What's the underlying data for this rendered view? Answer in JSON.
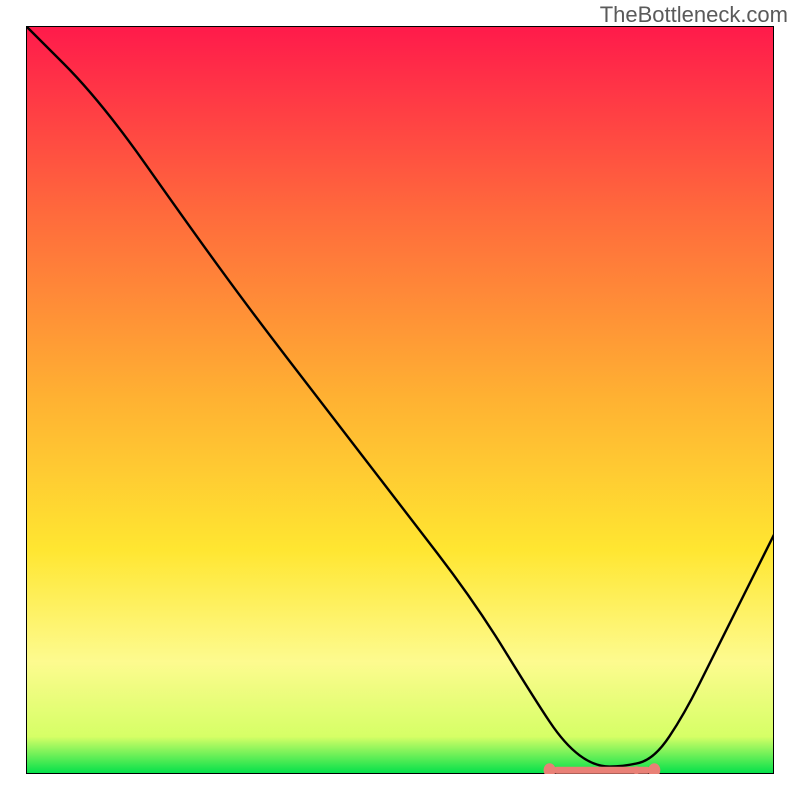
{
  "watermark": "TheBottleneck.com",
  "chart_data": {
    "type": "line",
    "title": "",
    "xlabel": "",
    "ylabel": "",
    "xlim": [
      0,
      100
    ],
    "ylim": [
      0,
      100
    ],
    "background_gradient": {
      "stops": [
        {
          "offset": 0.0,
          "color": "#ff1a4b"
        },
        {
          "offset": 0.25,
          "color": "#ff6a3c"
        },
        {
          "offset": 0.5,
          "color": "#ffb232"
        },
        {
          "offset": 0.7,
          "color": "#ffe631"
        },
        {
          "offset": 0.85,
          "color": "#fdfb8f"
        },
        {
          "offset": 0.95,
          "color": "#d6ff66"
        },
        {
          "offset": 1.0,
          "color": "#00e04a"
        }
      ]
    },
    "series": [
      {
        "name": "bottleneck-curve",
        "color": "#000000",
        "x": [
          0,
          10,
          22,
          30,
          40,
          50,
          60,
          68,
          72,
          76,
          80,
          84,
          88,
          92,
          100
        ],
        "y": [
          100,
          90,
          73,
          62,
          49,
          36,
          23,
          10,
          4,
          1,
          1,
          2,
          8,
          16,
          32
        ]
      }
    ],
    "annotations": [
      {
        "name": "optimal-marker",
        "shape": "hband-with-dots",
        "color": "#e98076",
        "x_start": 70,
        "x_end": 84,
        "y": 0.5
      }
    ]
  }
}
